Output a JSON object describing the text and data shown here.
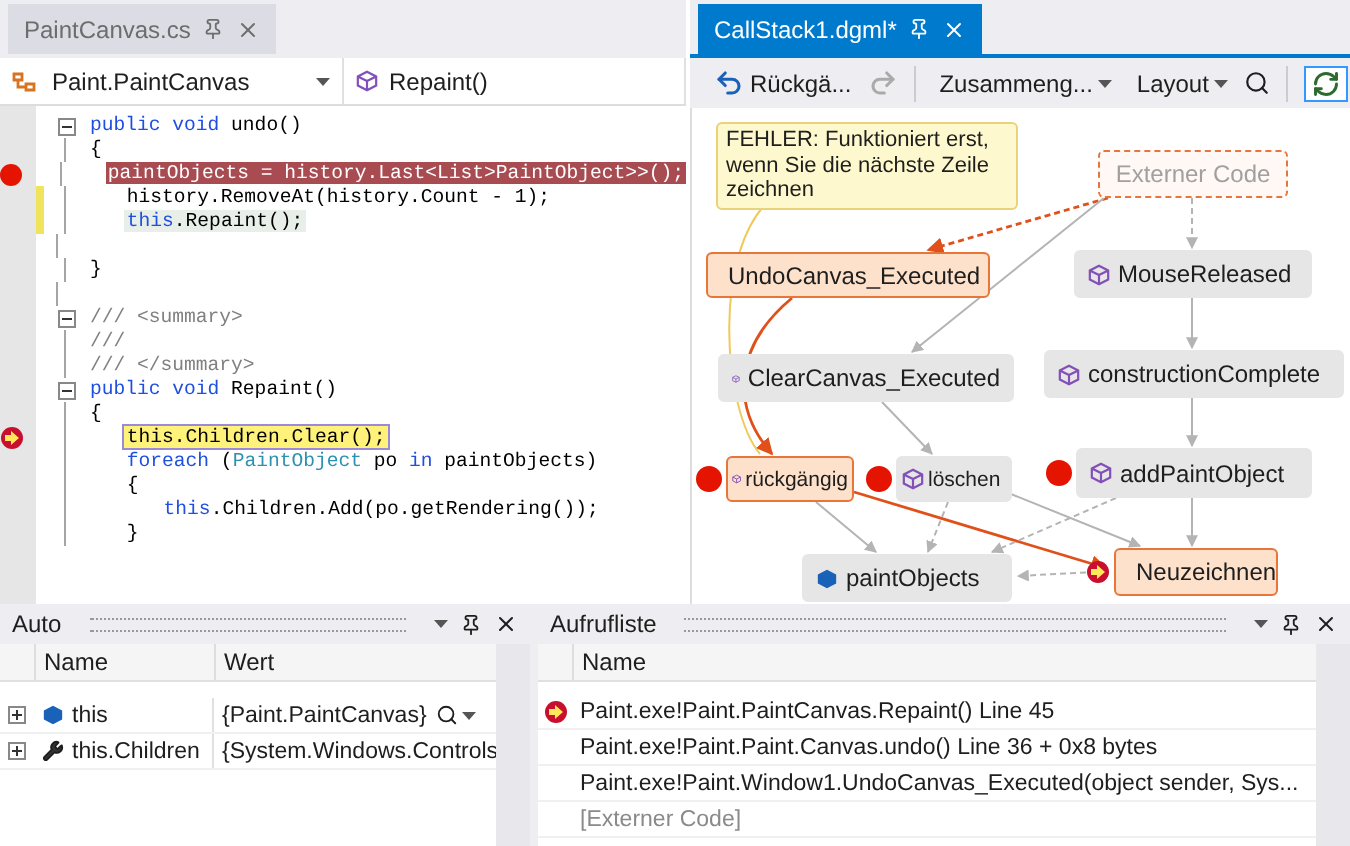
{
  "editor": {
    "tab": {
      "label": "PaintCanvas.cs",
      "selected": false
    },
    "nav": {
      "type_name": "Paint.PaintCanvas",
      "member_name": "Repaint()"
    },
    "code": [
      {
        "kind": "code",
        "fold": true,
        "breakpoint": false,
        "current": false,
        "changed": false,
        "related": false,
        "tokens": [
          {
            "kind": "keyword",
            "text": "public void"
          },
          {
            "kind": "plain",
            "text": " undo()"
          }
        ]
      },
      {
        "kind": "code",
        "fold": false,
        "breakpoint": false,
        "current": false,
        "changed": false,
        "related": false,
        "tokens": [
          {
            "kind": "plain",
            "text": "{"
          }
        ],
        "children": [
          {
            "kind": "code",
            "fold": false,
            "breakpoint": true,
            "current": false,
            "changed": false,
            "related": false,
            "tokens": [
              {
                "kind": "plain",
                "text": "paintObjects = history.Last<List>PaintObject>>();"
              }
            ]
          },
          {
            "kind": "code",
            "fold": false,
            "breakpoint": false,
            "current": false,
            "changed": true,
            "related": false,
            "tokens": [
              {
                "kind": "plain",
                "text": "history.RemoveAt(history.Count - 1);"
              }
            ]
          },
          {
            "kind": "code",
            "fold": false,
            "breakpoint": false,
            "current": false,
            "changed": true,
            "related": true,
            "tokens": [
              {
                "kind": "keyword",
                "text": "this"
              },
              {
                "kind": "plain",
                "text": ".Repaint();"
              }
            ]
          },
          {
            "kind": "blank"
          }
        ]
      },
      {
        "kind": "code",
        "fold": false,
        "breakpoint": false,
        "current": false,
        "changed": false,
        "related": false,
        "tokens": [
          {
            "kind": "plain",
            "text": "}"
          }
        ]
      },
      {
        "kind": "blank"
      },
      {
        "kind": "code",
        "fold": true,
        "breakpoint": false,
        "current": false,
        "changed": false,
        "related": false,
        "tokens": [
          {
            "kind": "comment",
            "text": "/// <summary>"
          }
        ]
      },
      {
        "kind": "code",
        "fold": false,
        "breakpoint": false,
        "current": false,
        "changed": false,
        "related": false,
        "tokens": [
          {
            "kind": "comment",
            "text": "///"
          }
        ]
      },
      {
        "kind": "code",
        "fold": false,
        "breakpoint": false,
        "current": false,
        "changed": false,
        "related": false,
        "tokens": [
          {
            "kind": "comment",
            "text": "/// </summary>"
          }
        ]
      },
      {
        "kind": "code",
        "fold": true,
        "breakpoint": false,
        "current": false,
        "changed": false,
        "related": false,
        "tokens": [
          {
            "kind": "keyword",
            "text": "public void"
          },
          {
            "kind": "plain",
            "text": " Repaint()"
          }
        ]
      },
      {
        "kind": "code",
        "fold": false,
        "breakpoint": false,
        "current": false,
        "changed": false,
        "related": false,
        "tokens": [
          {
            "kind": "plain",
            "text": "{"
          }
        ],
        "children": [
          {
            "kind": "code",
            "fold": false,
            "breakpoint": false,
            "current": true,
            "changed": false,
            "related": false,
            "tokens": [
              {
                "kind": "plain",
                "text": "this.Children.Clear();"
              }
            ]
          },
          {
            "kind": "code",
            "fold": false,
            "breakpoint": false,
            "current": false,
            "changed": false,
            "related": false,
            "tokens": [
              {
                "kind": "keyword",
                "text": "foreach"
              },
              {
                "kind": "plain",
                "text": " ("
              },
              {
                "kind": "type",
                "text": "PaintObject"
              },
              {
                "kind": "plain",
                "text": " po "
              },
              {
                "kind": "keyword",
                "text": "in"
              },
              {
                "kind": "plain",
                "text": " paintObjects)"
              }
            ]
          },
          {
            "kind": "code",
            "fold": false,
            "breakpoint": false,
            "current": false,
            "changed": false,
            "related": false,
            "tokens": [
              {
                "kind": "plain",
                "text": "{"
              }
            ],
            "children": [
              {
                "kind": "code",
                "fold": false,
                "breakpoint": false,
                "current": false,
                "changed": false,
                "related": false,
                "tokens": [
                  {
                    "kind": "keyword",
                    "text": "this"
                  },
                  {
                    "kind": "plain",
                    "text": ".Children.Add(po.getRendering());"
                  }
                ]
              }
            ]
          },
          {
            "kind": "code",
            "fold": false,
            "breakpoint": false,
            "current": false,
            "changed": false,
            "related": false,
            "tokens": [
              {
                "kind": "plain",
                "text": "}"
              }
            ]
          }
        ]
      }
    ]
  },
  "graph": {
    "tab": {
      "label": "CallStack1.dgml*",
      "selected": true
    },
    "toolbar": {
      "undo": "Rückgä...",
      "group": "Zusammeng...",
      "layout": "Layout",
      "sync_on": true
    },
    "note": "FEHLER: Funktioniert erst, wenn Sie die nächste Zeile zeichnen",
    "nodes": [
      {
        "label": "Externer Code",
        "kind": "external",
        "hot": false,
        "breakpoint": false,
        "current": false
      },
      {
        "label": "UndoCanvas_Executed",
        "kind": "method",
        "hot": true,
        "breakpoint": false,
        "current": false
      },
      {
        "label": "MouseReleased",
        "kind": "method",
        "hot": false,
        "breakpoint": false,
        "current": false
      },
      {
        "label": "ClearCanvas_Executed",
        "kind": "method",
        "hot": false,
        "breakpoint": false,
        "current": false
      },
      {
        "label": "constructionComplete",
        "kind": "method",
        "hot": false,
        "breakpoint": false,
        "current": false
      },
      {
        "label": "rückgängig",
        "kind": "method",
        "hot": true,
        "breakpoint": true,
        "current": false
      },
      {
        "label": "löschen",
        "kind": "method",
        "hot": false,
        "breakpoint": true,
        "current": false
      },
      {
        "label": "addPaintObject",
        "kind": "method",
        "hot": false,
        "breakpoint": true,
        "current": false
      },
      {
        "label": "paintObjects",
        "kind": "field",
        "hot": false,
        "breakpoint": false,
        "current": false
      },
      {
        "label": "Neuzeichnen",
        "kind": "method",
        "hot": true,
        "breakpoint": false,
        "current": true
      }
    ]
  },
  "auto_panel": {
    "title": "Auto",
    "columns": [
      "Name",
      "Wert"
    ],
    "rows": [
      {
        "name": "this",
        "kind": "object",
        "value": "{Paint.PaintCanvas}",
        "expanded": false,
        "inspect": true
      },
      {
        "name": "this.Children",
        "kind": "property",
        "value": "{System.Windows.Controls",
        "expanded": false,
        "inspect": false
      }
    ]
  },
  "callstack_panel": {
    "title": "Aufrufliste",
    "columns": [
      "Name"
    ],
    "rows": [
      {
        "text": "Paint.exe!Paint.PaintCanvas.Repaint() Line 45",
        "current": true,
        "external": false
      },
      {
        "text": "Paint.exe!Paint.Paint.Canvas.undo() Line 36 + 0x8 bytes",
        "current": false,
        "external": false
      },
      {
        "text": "Paint.exe!Paint.Window1.UndoCanvas_Executed(object sender, Sys...",
        "current": false,
        "external": false
      },
      {
        "text": "[Externer Code]",
        "current": false,
        "external": true
      }
    ]
  }
}
